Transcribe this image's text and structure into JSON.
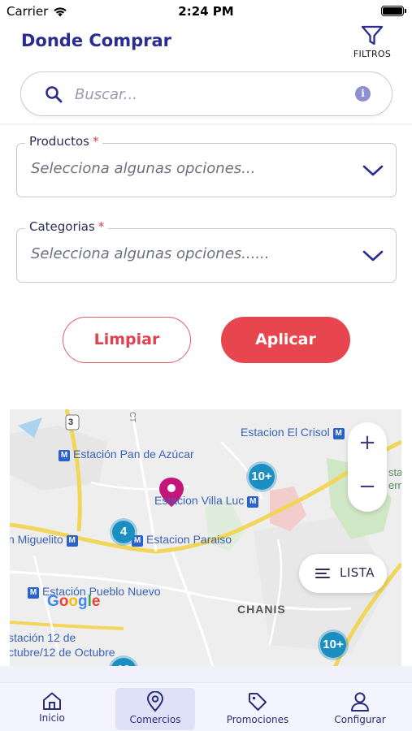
{
  "status_bar": {
    "carrier": "Carrier",
    "time": "2:24 PM"
  },
  "header": {
    "title": "Donde Comprar",
    "filter_label": "FILTROS"
  },
  "search": {
    "placeholder": "Buscar..."
  },
  "filters": [
    {
      "label": "Productos",
      "required": "*",
      "value": "Selecciona algunas opciones..."
    },
    {
      "label": "Categorias",
      "required": "*",
      "value": "Selecciona algunas opciones......"
    }
  ],
  "buttons": {
    "clear": "Limpiar",
    "apply": "Aplicar"
  },
  "map": {
    "labels": {
      "estacion_el_crisol": "Estacion El Crisol",
      "estacion_pan_de_azucar": "Estación Pan de Azúcar",
      "estacion_villa_lucre": "Estacion Villa Luc",
      "miguelito": "n Miguelito",
      "estacion_paraiso": "Estacion Paraiso",
      "estacion_pueblo_nuevo": "Estación Pueblo Nuevo",
      "chanis": "CHANIS",
      "estacion_12_oct_line1": "stación 12 de",
      "estacion_12_oct_line2": "ctubre/12 de Octubre",
      "road_3": "3",
      "road_ct": "CT",
      "edge_sta": "sta",
      "edge_ern": "ern",
      "metro_marker": "M"
    },
    "clusters": {
      "villa_lucre": "10+",
      "paraiso": "4",
      "chanis": "10+",
      "bottom": "10"
    },
    "zoom_in": "+",
    "zoom_out": "−",
    "list_button": "LISTA",
    "google_logo": "Google",
    "colors": {
      "cluster": "#1b8fc2",
      "pin": "#c4167a",
      "road": "#f2d65a",
      "metro": "#2b62c9"
    }
  },
  "tabs": [
    {
      "label": "Inicio",
      "icon": "home-icon"
    },
    {
      "label": "Comercios",
      "icon": "location-pin-icon",
      "active": true
    },
    {
      "label": "Promociones",
      "icon": "tag-icon"
    },
    {
      "label": "Configurar",
      "icon": "user-icon"
    }
  ],
  "colors": {
    "brand": "#2a2d8f",
    "accent": "#e8464f"
  }
}
